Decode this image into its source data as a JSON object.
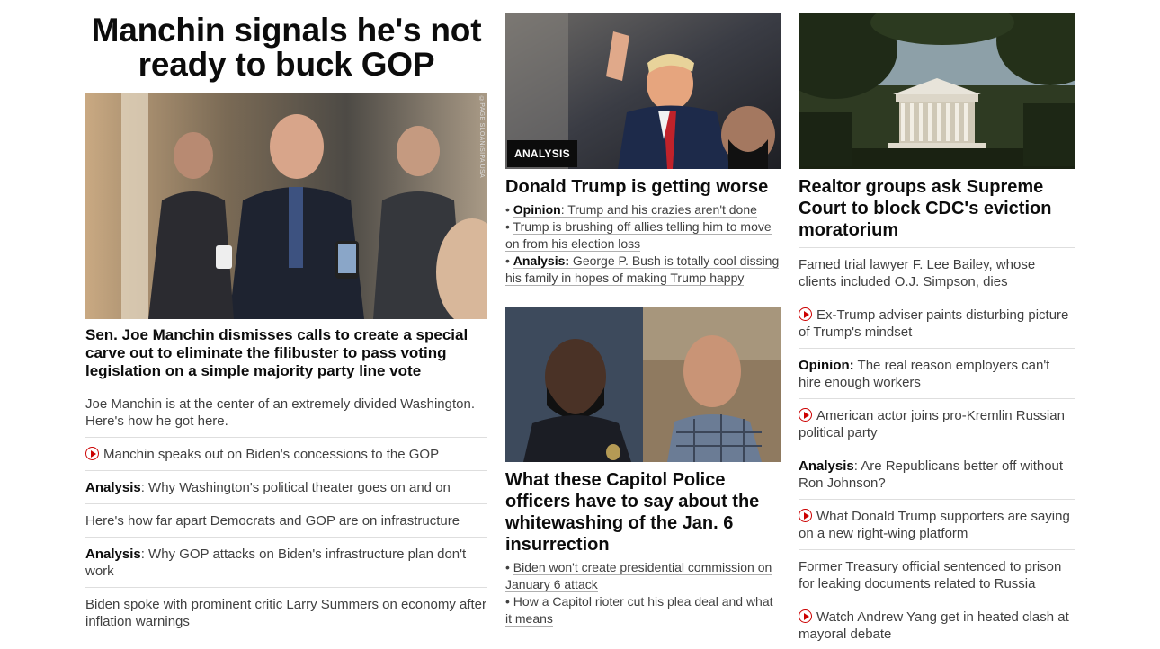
{
  "col1": {
    "hero_title": "Manchin signals he's not ready to buck GOP",
    "image_credit": "©PAGE SLOAN/SIPA USA",
    "lead_headline": "Sen. Joe Manchin dismisses calls to create a special carve out to eliminate the filibuster to pass voting legislation on a simple majority party line vote",
    "items": [
      {
        "prefix": "",
        "text": "Joe Manchin is at the center of an extremely divided Washington. Here's how he got here."
      },
      {
        "prefix": "",
        "text": "Manchin speaks out on Biden's concessions to the GOP",
        "video": true
      },
      {
        "prefix": "Analysis",
        "text": ": Why Washington's political theater goes on and on"
      },
      {
        "prefix": "",
        "text": "Here's how far apart Democrats and GOP are on infrastructure"
      },
      {
        "prefix": "Analysis",
        "text": ": Why GOP attacks on Biden's infrastructure plan don't work"
      },
      {
        "prefix": "",
        "text": "Biden spoke with prominent critic Larry Summers on economy after inflation warnings"
      }
    ]
  },
  "col2": {
    "story1": {
      "badge": "ANALYSIS",
      "headline": "Donald Trump is getting worse",
      "bullets": [
        {
          "prefix": "Opinion",
          "text": ": Trump and his crazies aren't done"
        },
        {
          "prefix": "",
          "text": "Trump is brushing off allies telling him to move on from his election loss"
        },
        {
          "prefix": "Analysis:",
          "text": " George P. Bush is totally cool dissing his family in hopes of making Trump happy"
        }
      ]
    },
    "story2": {
      "headline": "What these Capitol Police officers have to say about the whitewashing of the Jan. 6 insurrection",
      "bullets": [
        {
          "prefix": "",
          "text": "Biden won't create presidential commission on January 6 attack"
        },
        {
          "prefix": "",
          "text": "How a Capitol rioter cut his plea deal and what it means"
        }
      ]
    }
  },
  "col3": {
    "headline": "Realtor groups ask Supreme Court to block CDC's eviction moratorium",
    "items": [
      {
        "prefix": "",
        "text": "Famed trial lawyer F. Lee Bailey, whose clients included O.J. Simpson, dies"
      },
      {
        "prefix": "",
        "text": "Ex-Trump adviser paints disturbing picture of Trump's mindset",
        "video": true
      },
      {
        "prefix": "Opinion:",
        "text": " The real reason employers can't hire enough workers"
      },
      {
        "prefix": "",
        "text": "American actor joins pro-Kremlin Russian political party",
        "video": true
      },
      {
        "prefix": "Analysis",
        "text": ": Are Republicans better off without Ron Johnson?"
      },
      {
        "prefix": "",
        "text": "What Donald Trump supporters are saying on a new right-wing platform",
        "video": true
      },
      {
        "prefix": "",
        "text": "Former Treasury official sentenced to prison for leaking documents related to Russia"
      },
      {
        "prefix": "",
        "text": "Watch Andrew Yang get in heated clash at mayoral debate",
        "video": true
      }
    ]
  }
}
